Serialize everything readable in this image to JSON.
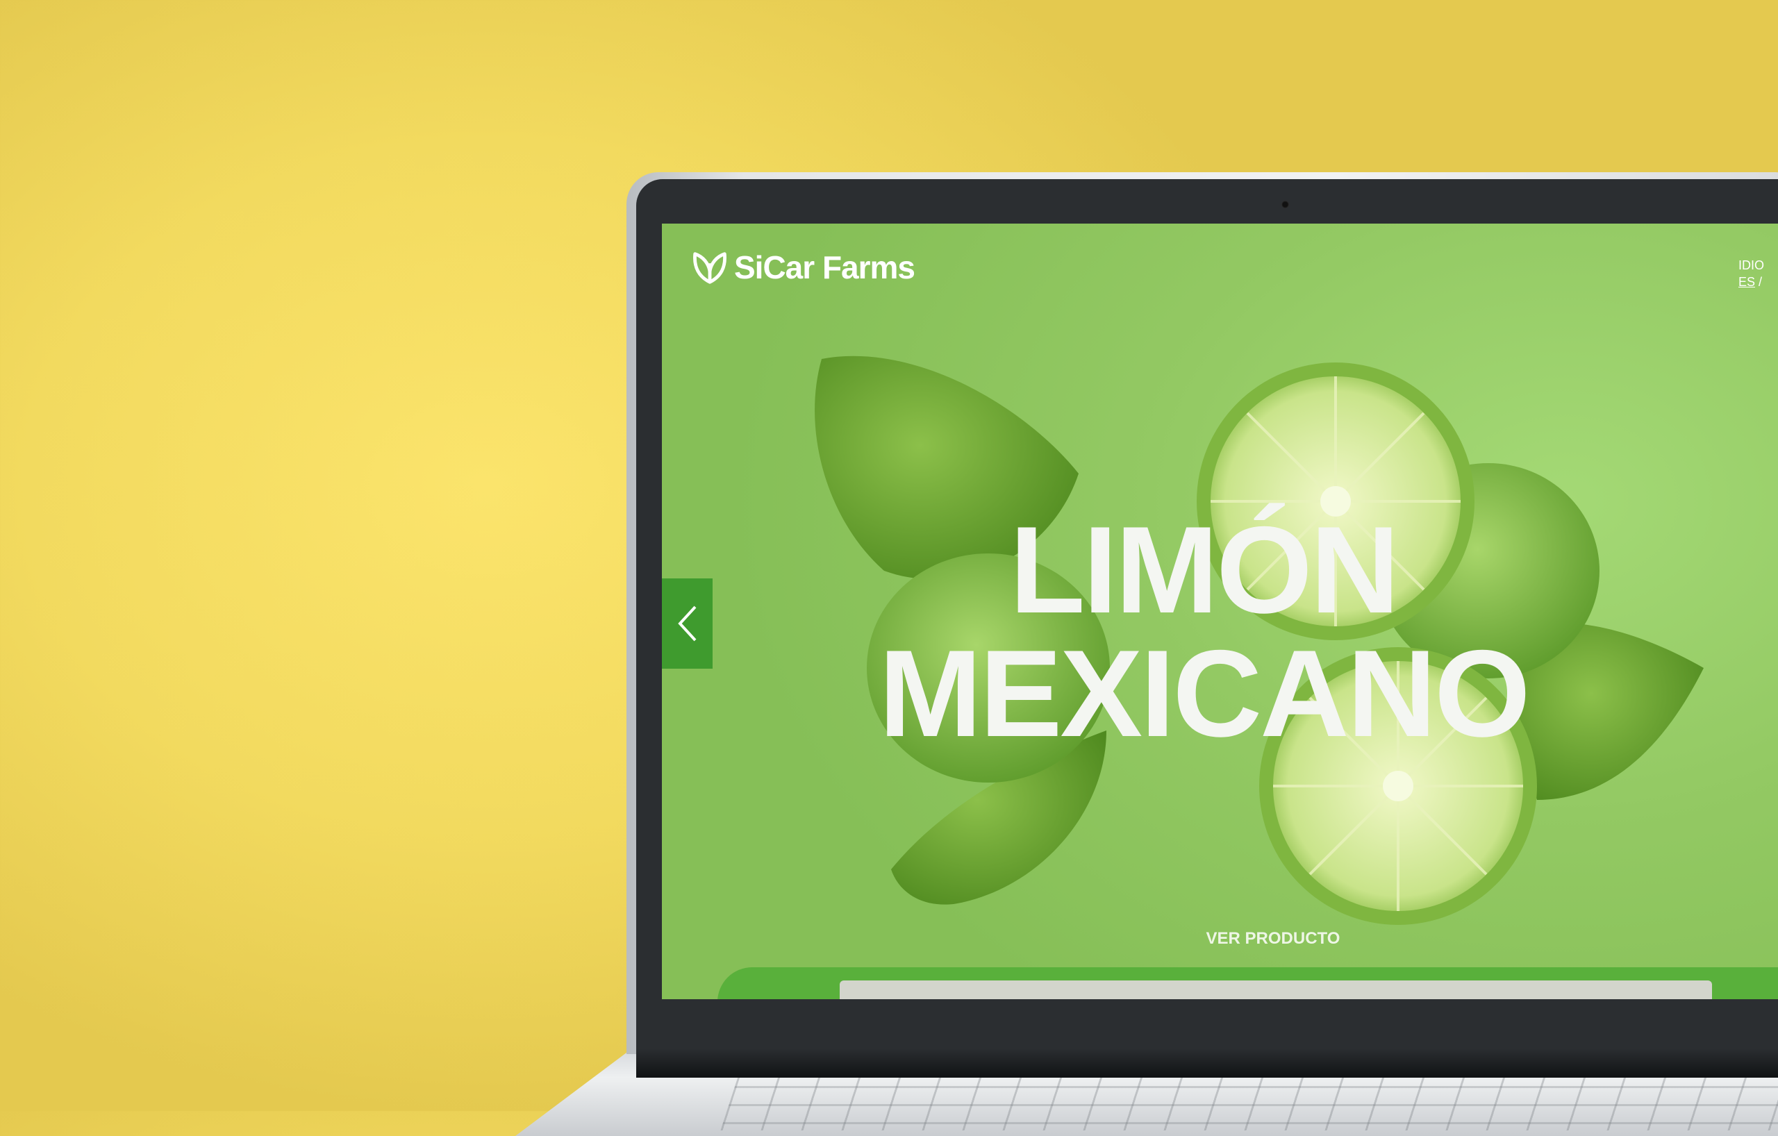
{
  "brand": {
    "name": "SiCar Farms",
    "logo_icon": "leaf-icon"
  },
  "language": {
    "label": "IDIO",
    "current": "ES",
    "separator": "/"
  },
  "hero": {
    "title_line1": "LIMÓN",
    "title_line2": "MEXICANO",
    "cta_label": "VER PRODUCTO",
    "prev_icon": "chevron-left-icon"
  },
  "colors": {
    "background": "#f2da5f",
    "screen_green": "#93c963",
    "accent_green": "#3f9b2e",
    "text": "#ffffff"
  }
}
